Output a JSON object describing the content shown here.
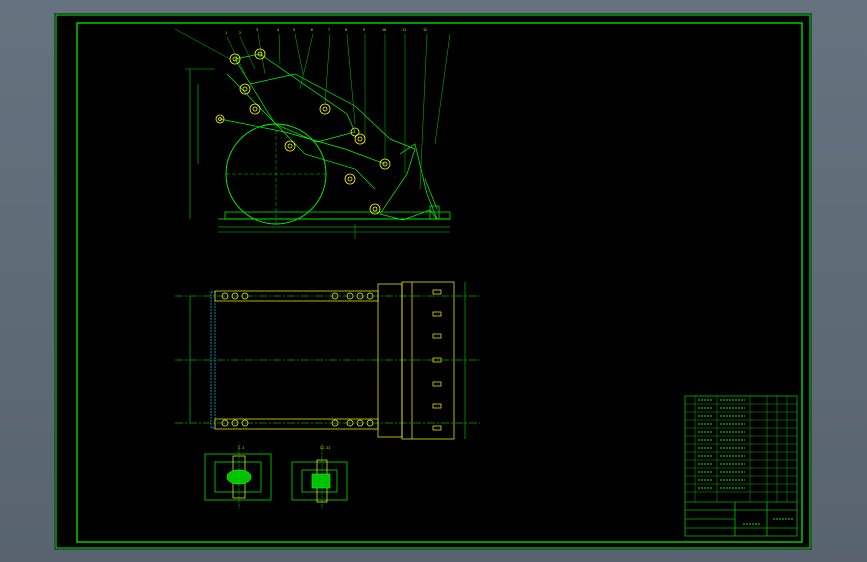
{
  "viewport": {
    "background": "#5e6a7a"
  },
  "drawing": {
    "background": "#000000",
    "colors": {
      "frame": "#00ff00",
      "part": "#ffff00",
      "green": "#00d000",
      "cyan": "#00bfff",
      "dim": "#00ff00"
    },
    "balloons": [
      "1",
      "2",
      "3",
      "4",
      "5",
      "6",
      "7",
      "8",
      "9",
      "10",
      "11",
      "12"
    ],
    "section_labels": [
      "I-I",
      "II-II"
    ],
    "icons": [
      "drawing-frame",
      "title-block-table"
    ]
  }
}
